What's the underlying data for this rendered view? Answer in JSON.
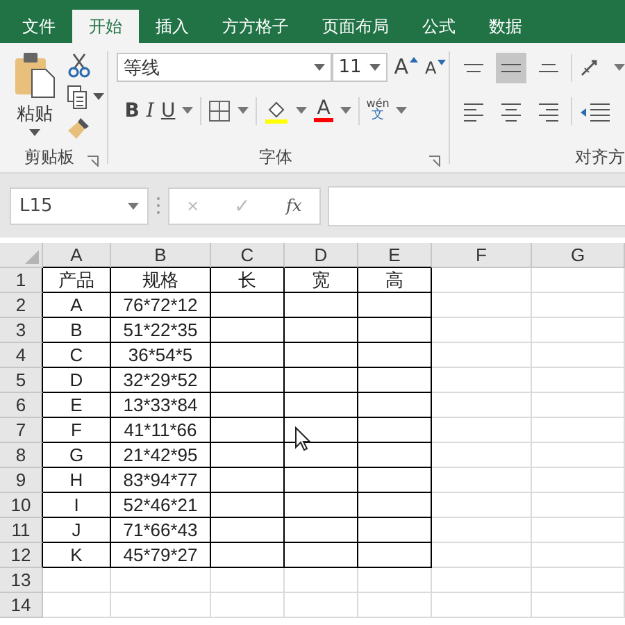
{
  "tabs": [
    {
      "label": "文件",
      "selected": false
    },
    {
      "label": "开始",
      "selected": true
    },
    {
      "label": "插入",
      "selected": false
    },
    {
      "label": "方方格子",
      "selected": false
    },
    {
      "label": "页面布局",
      "selected": false
    },
    {
      "label": "公式",
      "selected": false
    },
    {
      "label": "数据",
      "selected": false
    }
  ],
  "clipboard": {
    "paste": "粘贴",
    "group_label": "剪贴板"
  },
  "font": {
    "name": "等线",
    "size": "11",
    "grow": "A",
    "shrink": "A",
    "bold": "B",
    "italic": "I",
    "underline": "U",
    "font_color": "A",
    "phonetic_top": "wén",
    "phonetic_bottom": "文",
    "group_label": "字体"
  },
  "alignment": {
    "group_label": "对齐方",
    "top_row": [
      {
        "kind": "top",
        "selected": false
      },
      {
        "kind": "middle",
        "selected": true
      },
      {
        "kind": "bottom",
        "selected": false
      }
    ],
    "bottom_row": [
      {
        "kind": "left",
        "selected": false
      },
      {
        "kind": "center",
        "selected": false
      },
      {
        "kind": "right",
        "selected": false
      }
    ]
  },
  "name_box": "L15",
  "formula_bar": {
    "cancel": "×",
    "enter": "✓",
    "function": "fx"
  },
  "sheet": {
    "columns": [
      "A",
      "B",
      "C",
      "D",
      "E",
      "F",
      "G"
    ],
    "rows": [
      {
        "number": "1",
        "cells": [
          "产品",
          "规格",
          "长",
          "宽",
          "高"
        ]
      },
      {
        "number": "2",
        "cells": [
          "A",
          "76*72*12"
        ]
      },
      {
        "number": "3",
        "cells": [
          "B",
          "51*22*35"
        ]
      },
      {
        "number": "4",
        "cells": [
          "C",
          "36*54*5"
        ]
      },
      {
        "number": "5",
        "cells": [
          "D",
          "32*29*52"
        ]
      },
      {
        "number": "6",
        "cells": [
          "E",
          "13*33*84"
        ]
      },
      {
        "number": "7",
        "cells": [
          "F",
          "41*11*66"
        ]
      },
      {
        "number": "8",
        "cells": [
          "G",
          "21*42*95"
        ]
      },
      {
        "number": "9",
        "cells": [
          "H",
          "83*94*77"
        ]
      },
      {
        "number": "10",
        "cells": [
          "I",
          "52*46*21"
        ]
      },
      {
        "number": "11",
        "cells": [
          "J",
          "71*66*43"
        ]
      },
      {
        "number": "12",
        "cells": [
          "K",
          "45*79*27"
        ]
      },
      {
        "number": "13",
        "cells": []
      },
      {
        "number": "14",
        "cells": []
      }
    ]
  }
}
